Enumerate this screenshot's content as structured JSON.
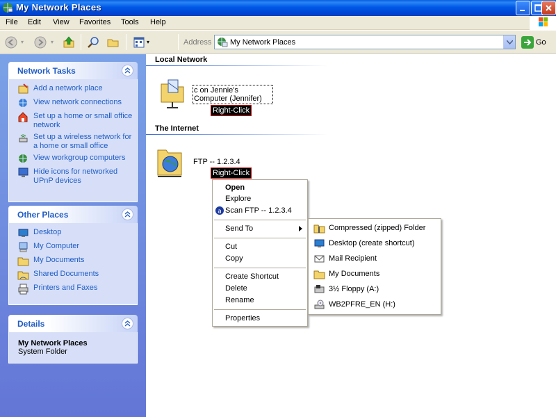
{
  "window": {
    "title": "My Network Places"
  },
  "menubar": {
    "items": [
      "File",
      "Edit",
      "View",
      "Favorites",
      "Tools",
      "Help"
    ]
  },
  "toolbar": {
    "address_label": "Address",
    "address_value": "My Network Places",
    "go_label": "Go"
  },
  "sidebar": {
    "network_tasks": {
      "title": "Network Tasks",
      "items": [
        "Add a network place",
        "View network connections",
        "Set up a home or small office network",
        "Set up a wireless network for a home or small office",
        "View workgroup computers",
        "Hide icons for networked UPnP devices"
      ]
    },
    "other_places": {
      "title": "Other Places",
      "items": [
        "Desktop",
        "My Computer",
        "My Documents",
        "Shared Documents",
        "Printers and Faxes"
      ]
    },
    "details": {
      "title": "Details",
      "name": "My Network Places",
      "type": "System Folder"
    }
  },
  "content": {
    "local_network": {
      "heading": "Local Network",
      "item_label": "c on Jennie's Computer (Jennifer)",
      "annotation": "Right-Click"
    },
    "internet": {
      "heading": "The Internet",
      "item_label": "FTP -- 1.2.3.4",
      "annotation": "Right-Click"
    }
  },
  "context_menu": {
    "open": "Open",
    "explore": "Explore",
    "scan": "Scan FTP -- 1.2.3.4",
    "send_to": "Send To",
    "cut": "Cut",
    "copy": "Copy",
    "create_shortcut": "Create Shortcut",
    "delete": "Delete",
    "rename": "Rename",
    "properties": "Properties"
  },
  "send_to_menu": {
    "items": [
      "Compressed (zipped) Folder",
      "Desktop (create shortcut)",
      "Mail Recipient",
      "My Documents",
      "3½ Floppy (A:)",
      "WB2PFRE_EN (H:)"
    ]
  },
  "colors": {
    "title_bar": "#0058e6",
    "left_pane": "#6e8ee0",
    "link": "#215dc6",
    "annotation_bg": "#000000"
  }
}
